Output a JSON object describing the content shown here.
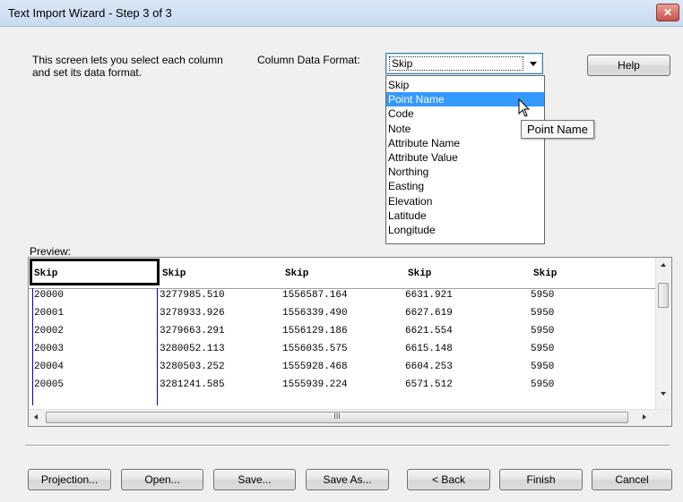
{
  "window": {
    "title": "Text Import Wizard - Step 3 of 3",
    "close_label": "✕"
  },
  "description": "This screen lets you select each column and set its data format.",
  "column_data_format": {
    "label": "Column Data Format:",
    "selected": "Skip",
    "options": [
      "Skip",
      "Point Name",
      "Code",
      "Note",
      "Attribute Name",
      "Attribute Value",
      "Northing",
      "Easting",
      "Elevation",
      "Latitude",
      "Longitude"
    ],
    "highlighted": "Point Name"
  },
  "tooltip": "Point Name",
  "help_label": "Help",
  "preview": {
    "label": "Preview:",
    "headers": [
      "Skip",
      "Skip",
      "Skip",
      "Skip",
      "Skip"
    ],
    "rows": [
      [
        "20000",
        "3277985.510",
        "1556587.164",
        "6631.921",
        "5950"
      ],
      [
        "20001",
        "3278933.926",
        "1556339.490",
        "6627.619",
        "5950"
      ],
      [
        "20002",
        "3279663.291",
        "1556129.186",
        "6621.554",
        "5950"
      ],
      [
        "20003",
        "3280052.113",
        "1556035.575",
        "6615.148",
        "5950"
      ],
      [
        "20004",
        "3280503.252",
        "1555928.468",
        "6604.253",
        "5950"
      ],
      [
        "20005",
        "3281241.585",
        "1555939.224",
        "6571.512",
        "5950"
      ]
    ],
    "hscroll_grip": "III"
  },
  "buttons": {
    "projection": "Projection...",
    "open": "Open...",
    "save": "Save...",
    "save_as": "Save As...",
    "back": "< Back",
    "finish": "Finish",
    "cancel": "Cancel"
  }
}
